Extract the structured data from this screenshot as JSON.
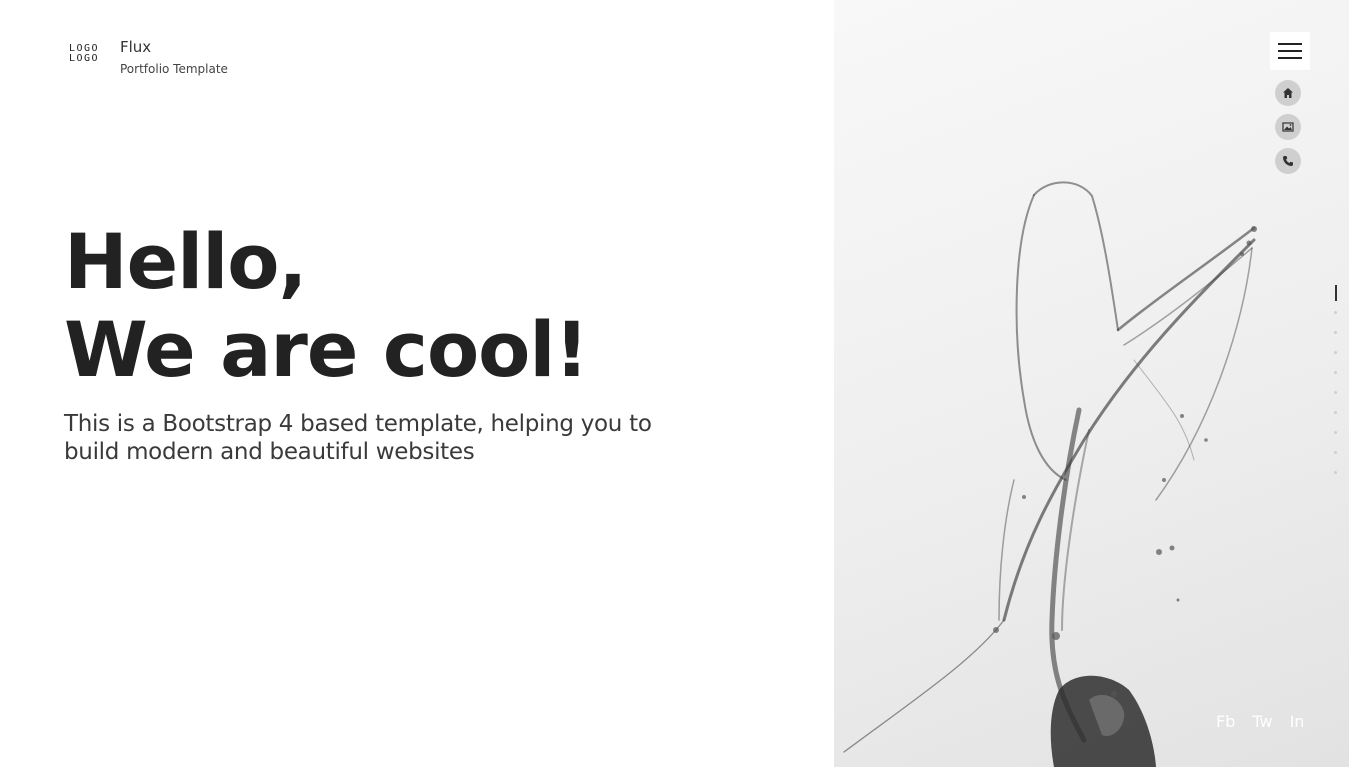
{
  "brand": {
    "logo_text_line1": "LOGO",
    "logo_text_line2": "LOGO",
    "site_name": "Flux",
    "tagline": "Portfolio Template"
  },
  "hero": {
    "title_line1": "Hello,",
    "title_line2": "We are cool!",
    "subtitle": "This is a Bootstrap 4 based template, helping you to build modern and beautiful websites"
  },
  "nav": {
    "menu_icon": "hamburger-icon",
    "items": [
      {
        "icon": "home-icon"
      },
      {
        "icon": "image-icon"
      },
      {
        "icon": "phone-icon"
      }
    ]
  },
  "section_indicator": {
    "active_index": 0,
    "count": 10
  },
  "social": {
    "facebook": "Fb",
    "twitter": "Tw",
    "linkedin": "In"
  },
  "colors": {
    "text_dark": "#222222",
    "nav_circle": "#cfcfcf",
    "panel_bg": "#eeeeee",
    "social_text": "#ffffff"
  }
}
